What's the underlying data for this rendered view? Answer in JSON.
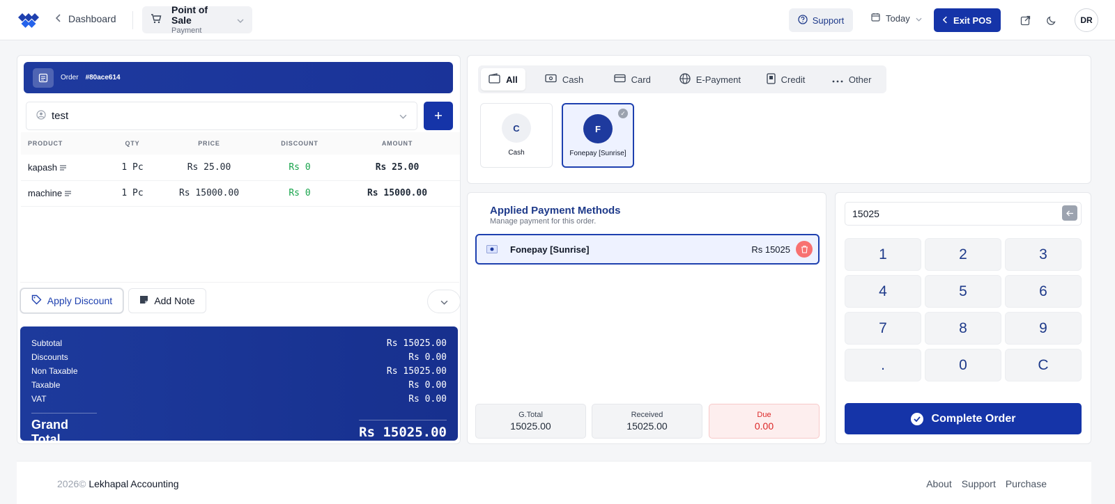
{
  "topbar": {
    "back_label": "Dashboard",
    "module_title": "Point of Sale",
    "module_subtitle": "Payment",
    "support_label": "Support",
    "date_filter": "Today",
    "exit_label": "Exit POS",
    "avatar_initials": "DR"
  },
  "order": {
    "label": "Order",
    "id": "#80ace614",
    "customer": "test",
    "columns": [
      "PRODUCT",
      "QTY",
      "PRICE",
      "DISCOUNT",
      "AMOUNT"
    ],
    "items": [
      {
        "product": "kapash",
        "qty": "1 Pc",
        "price": "Rs 25.00",
        "discount": "Rs 0",
        "amount": "Rs 25.00"
      },
      {
        "product": "machine",
        "qty": "1 Pc",
        "price": "Rs 15000.00",
        "discount": "Rs 0",
        "amount": "Rs 15000.00"
      }
    ],
    "apply_discount_label": "Apply Discount",
    "add_note_label": "Add Note"
  },
  "totals": {
    "subtotal_label": "Subtotal",
    "subtotal": "Rs 15025.00",
    "discounts_label": "Discounts",
    "discounts": "Rs 0.00",
    "non_taxable_label": "Non Taxable",
    "non_taxable": "Rs 15025.00",
    "taxable_label": "Taxable",
    "taxable": "Rs 0.00",
    "vat_label": "VAT",
    "vat": "Rs 0.00",
    "grand_label": "Grand Total",
    "grand": "Rs 15025.00"
  },
  "payment_tabs": [
    "All",
    "Cash",
    "Card",
    "E-Payment",
    "Credit",
    "Other"
  ],
  "payment_methods": [
    {
      "initial": "C",
      "name": "Cash"
    },
    {
      "initial": "F",
      "name": "Fonepay [Sunrise]"
    }
  ],
  "applied": {
    "title": "Applied Payment Methods",
    "subtitle": "Manage payment for this order.",
    "method_name": "Fonepay [Sunrise]",
    "method_amount": "Rs 15025",
    "gtotal_label": "G.Total",
    "gtotal": "15025.00",
    "received_label": "Received",
    "received": "15025.00",
    "due_label": "Due",
    "due": "0.00"
  },
  "keypad": {
    "value": "15025",
    "keys": [
      "1",
      "2",
      "3",
      "4",
      "5",
      "6",
      "7",
      "8",
      "9",
      ".",
      "0",
      "C"
    ],
    "complete_label": "Complete Order"
  },
  "footer": {
    "year": "2026©",
    "company": "Lekhapal Accounting",
    "links": [
      "About",
      "Support",
      "Purchase"
    ]
  },
  "colors": {
    "primary": "#1534a8",
    "success": "#16a34a",
    "danger": "#dc2626"
  }
}
